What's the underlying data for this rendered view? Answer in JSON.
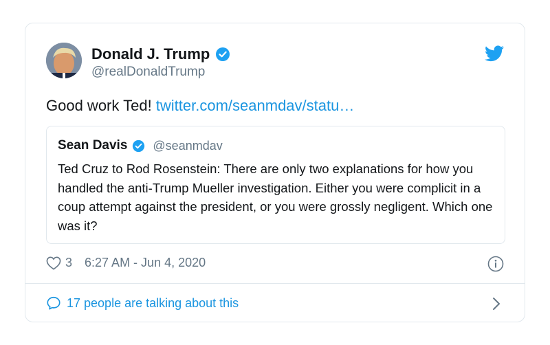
{
  "tweet": {
    "author_name": "Donald J. Trump",
    "author_handle": "@realDonaldTrump",
    "text": "Good work Ted! ",
    "link_text": "twitter.com/seanmdav/statu…",
    "likes": "3",
    "timestamp": "6:27 AM - Jun 4, 2020",
    "talking": "17 people are talking about this"
  },
  "quote": {
    "author_name": "Sean Davis",
    "author_handle": "@seanmdav",
    "text": "Ted Cruz to Rod Rosenstein: There are only two explanations for how you handled the anti-Trump Mueller investigation. Either you were complicit in a coup attempt against the president, or you were grossly negligent. Which one was it?"
  },
  "colors": {
    "link": "#1b95e0",
    "secondary_text": "#657786",
    "border": "#e1e8ed",
    "verified": "#1da1f2"
  },
  "icons": [
    "twitter-logo-icon",
    "verified-badge-icon",
    "heart-icon",
    "info-icon",
    "comment-bubble-icon",
    "chevron-right-icon"
  ]
}
